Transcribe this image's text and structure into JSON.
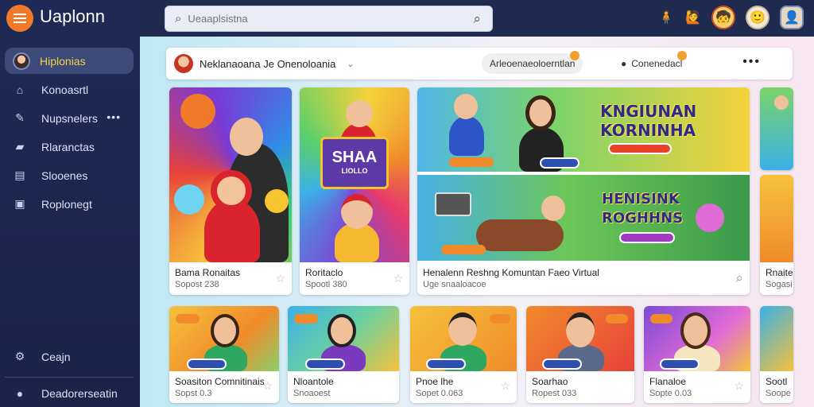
{
  "app": {
    "title": "Uaplonn"
  },
  "sidebar": {
    "items": [
      {
        "label": "Hiplonias",
        "icon": "user-avatar"
      },
      {
        "label": "Konoasrtl",
        "icon": "home-icon"
      },
      {
        "label": "Nupsnelers",
        "icon": "brush-icon",
        "more": "•••"
      },
      {
        "label": "Rlaranctas",
        "icon": "folder-icon"
      },
      {
        "label": "Slooenes",
        "icon": "grid-icon"
      },
      {
        "label": "Roplonegt",
        "icon": "bag-icon"
      }
    ],
    "bottom": [
      {
        "label": "Ceajn",
        "icon": "gear-icon"
      },
      {
        "label": "Deadorerseatin",
        "icon": "user-icon"
      }
    ]
  },
  "search": {
    "placeholder": "Ueaaplsistna"
  },
  "page_header": {
    "title": "Neklanaoana Je Onenoloania",
    "chip1": "Arleoenaeoloerntlan",
    "chip2": "Conenedacl",
    "more": "•••"
  },
  "cards_row1": [
    {
      "title": "Bama Ronaitas",
      "sub": "Sopost 238"
    },
    {
      "title": "Roritaclo",
      "sub": "Spootl 380"
    }
  ],
  "feature": {
    "banner1_line1": "KNGIUNAN",
    "banner1_line2": "KORNINHA",
    "banner2_line1": "HENISINK",
    "banner2_line2": "ROGHHNS",
    "title": "Henalenn Reshng Komuntan Faeo Virtual",
    "sub": "Uge snaaloacoe",
    "edge_title": "Rnaite",
    "edge_sub": "Sogasi"
  },
  "thumb_text": {
    "sign_line1": "SHAA",
    "sign_line2": "LIOLLO"
  },
  "cards_row2": [
    {
      "title": "Soasiton Comnitinais",
      "sub": "Sopst 0.3"
    },
    {
      "title": "Nloantole",
      "sub": "Snoaoest"
    },
    {
      "title": "Pnoe lhe",
      "sub": "Sopet 0.063"
    },
    {
      "title": "Soarhao",
      "sub": "Ropest 033"
    },
    {
      "title": "Flanaloe",
      "sub": "Sopte 0.03"
    },
    {
      "title": "Sootl",
      "sub": "Soope"
    }
  ],
  "colors": {
    "sidebar": "#1e2a55",
    "accent": "#f07a2a",
    "active_label": "#f2d24a"
  }
}
